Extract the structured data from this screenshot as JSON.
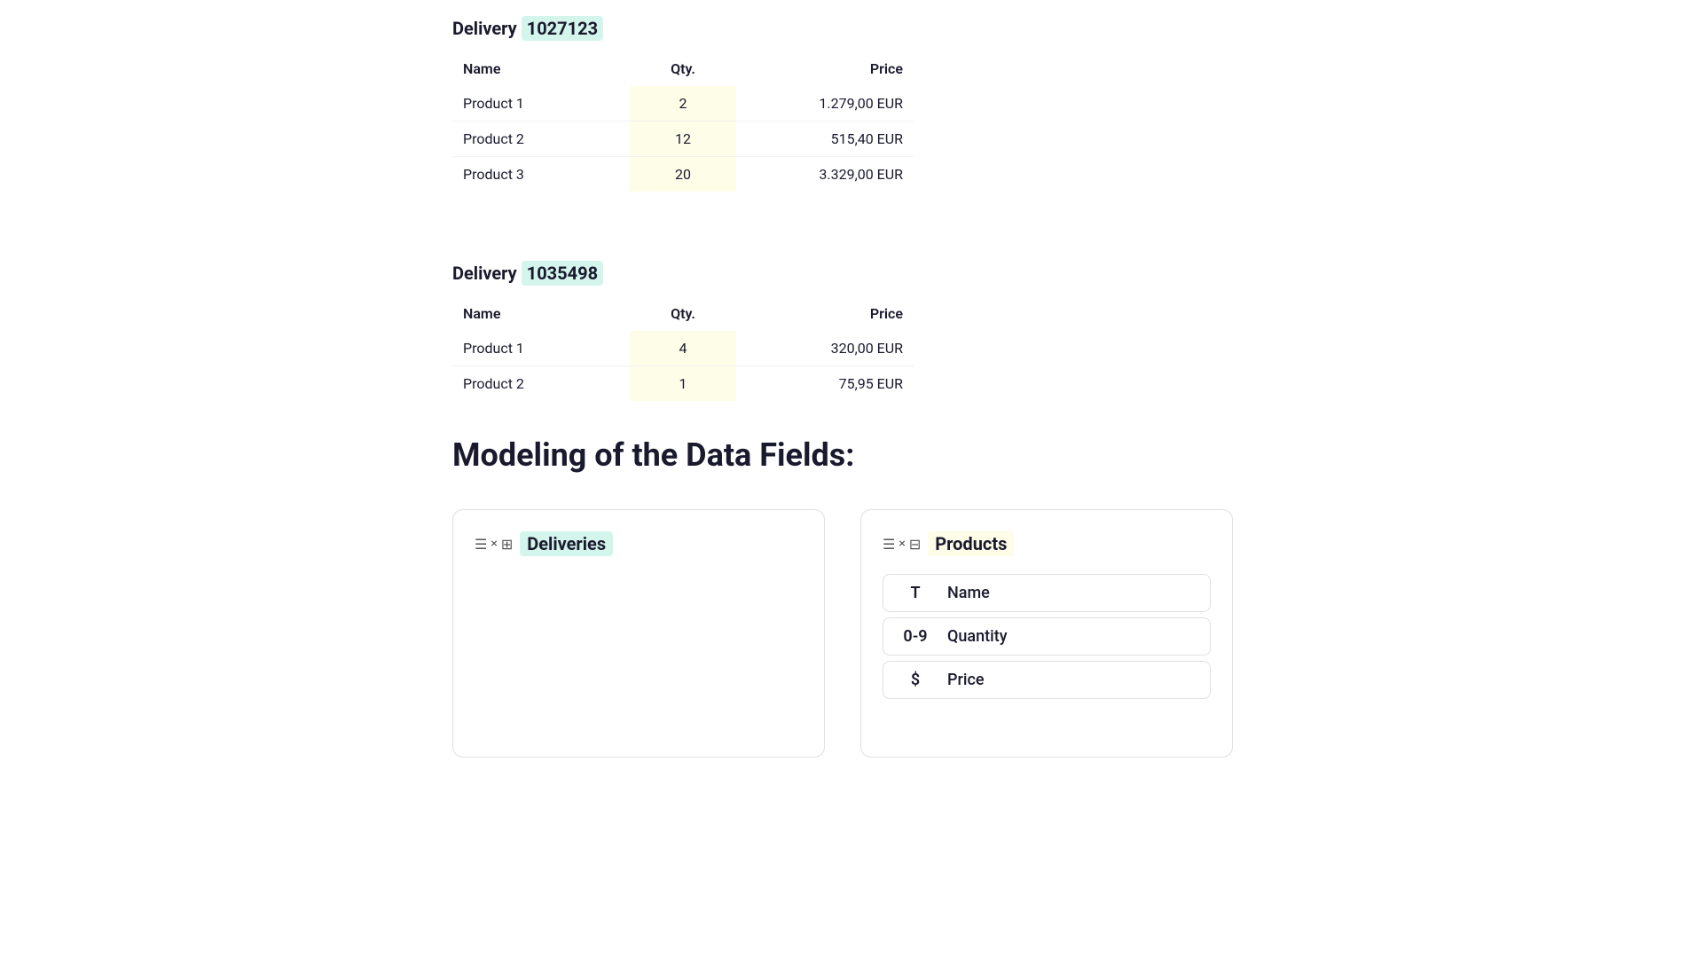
{
  "delivery1": {
    "title_prefix": "Delivery ",
    "title_number": "1027123",
    "columns": {
      "name": "Name",
      "qty": "Qty.",
      "price": "Price"
    },
    "rows": [
      {
        "name": "Product 1",
        "qty": "2",
        "price": "1.279,00 EUR"
      },
      {
        "name": "Product 2",
        "qty": "12",
        "price": "515,40 EUR"
      },
      {
        "name": "Product 3",
        "qty": "20",
        "price": "3.329,00 EUR"
      }
    ]
  },
  "delivery2": {
    "title_prefix": "Delivery ",
    "title_number": "1035498",
    "columns": {
      "name": "Name",
      "qty": "Qty.",
      "price": "Price"
    },
    "rows": [
      {
        "name": "Product 1",
        "qty": "4",
        "price": "320,00 EUR"
      },
      {
        "name": "Product 2",
        "qty": "1",
        "price": "75,95 EUR"
      }
    ]
  },
  "modeling": {
    "title": "Modeling of the Data Fields:",
    "card_deliveries": {
      "label": "Deliveries",
      "label_color": "green"
    },
    "card_products": {
      "label": "Products",
      "label_color": "yellow",
      "fields": [
        {
          "icon": "T",
          "name": "Name"
        },
        {
          "icon": "0-9",
          "name": "Quantity"
        },
        {
          "icon": "$",
          "name": "Price"
        }
      ]
    }
  }
}
